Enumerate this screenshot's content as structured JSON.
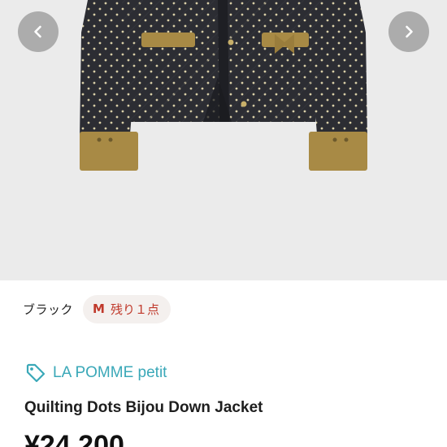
{
  "gallery": {
    "image_name": "product-photo",
    "prev_icon": "chevron-left-icon",
    "next_icon": "chevron-right-icon"
  },
  "variant": {
    "color": "ブラック",
    "size": "M",
    "stock_text": "残り１点"
  },
  "brand": {
    "icon": "tag-icon",
    "name": "LA POMME petit"
  },
  "product": {
    "title": "Quilting Dots Bijou Down Jacket",
    "price": "¥24,200"
  },
  "colors": {
    "brand_accent": "#3aa8b8",
    "stock_red": "#c0392b"
  }
}
